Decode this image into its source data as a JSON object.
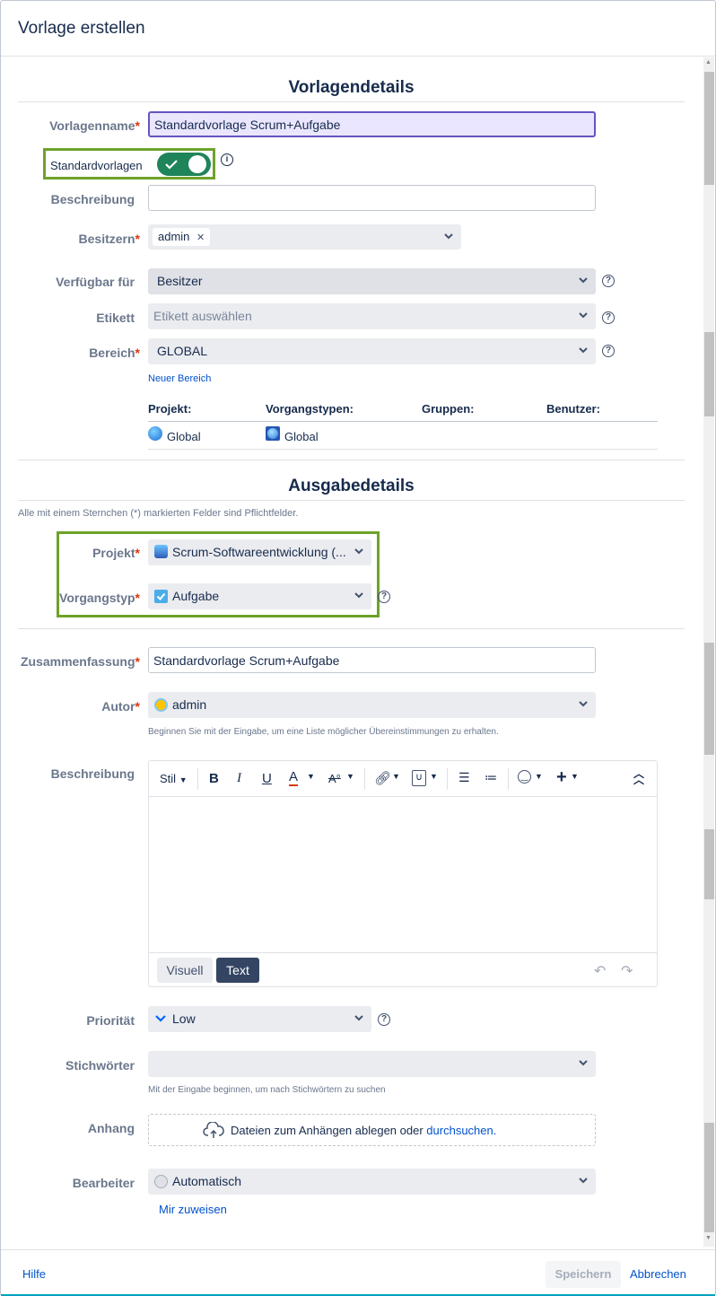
{
  "dialog_title": "Vorlage erstellen",
  "template_section": {
    "title": "Vorlagendetails",
    "name_label": "Vorlagenname",
    "name_value": "Standardvorlage Scrum+Aufgabe",
    "default_label": "Standardvorlagen",
    "description_label": "Beschreibung",
    "description_value": "",
    "owners_label": "Besitzern",
    "owner_tag": "admin",
    "available_label": "Verfügbar für",
    "available_value": "Besitzer",
    "label_label": "Etikett",
    "label_placeholder": "Etikett auswählen",
    "scope_label": "Bereich",
    "scope_value": "GLOBAL",
    "new_scope_link": "Neuer Bereich",
    "scope_table": {
      "headers": [
        "Projekt:",
        "Vorgangstypen:",
        "Gruppen:",
        "Benutzer:"
      ],
      "project": "Global",
      "issue_types": "Global"
    }
  },
  "issue_section": {
    "title": "Ausgabedetails",
    "required_note": "Alle mit einem Sternchen (*) markierten Felder sind Pflichtfelder.",
    "project_label": "Projekt",
    "project_value": "Scrum-Softwareentwicklung (...",
    "issuetype_label": "Vorgangstyp",
    "issuetype_value": "Aufgabe",
    "summary_label": "Zusammenfassung",
    "summary_value": "Standardvorlage Scrum+Aufgabe",
    "author_label": "Autor",
    "author_value": "admin",
    "author_hint": "Beginnen Sie mit der Eingabe, um eine Liste möglicher Übereinstimmungen zu erhalten.",
    "desc_label": "Beschreibung",
    "editor": {
      "style_label": "Stil",
      "bold": "B",
      "italic": "I",
      "underline": "U",
      "color": "A",
      "tab_visual": "Visuell",
      "tab_text": "Text"
    },
    "priority_label": "Priorität",
    "priority_value": "Low",
    "keywords_label": "Stichwörter",
    "keywords_hint": "Mit der Eingabe beginnen, um nach Stichwörtern zu suchen",
    "attachment_label": "Anhang",
    "attachment_text": "Dateien zum Anhängen ablegen oder",
    "attachment_link": "durchsuchen.",
    "assignee_label": "Bearbeiter",
    "assignee_value": "Automatisch",
    "assign_me_link": "Mir zuweisen"
  },
  "footer": {
    "help": "Hilfe",
    "save": "Speichern",
    "cancel": "Abbrechen"
  },
  "colors": {
    "accent": "#0052cc",
    "toggle_on": "#1f845a",
    "highlight_box": "#6ea22a",
    "required": "#de350b"
  }
}
